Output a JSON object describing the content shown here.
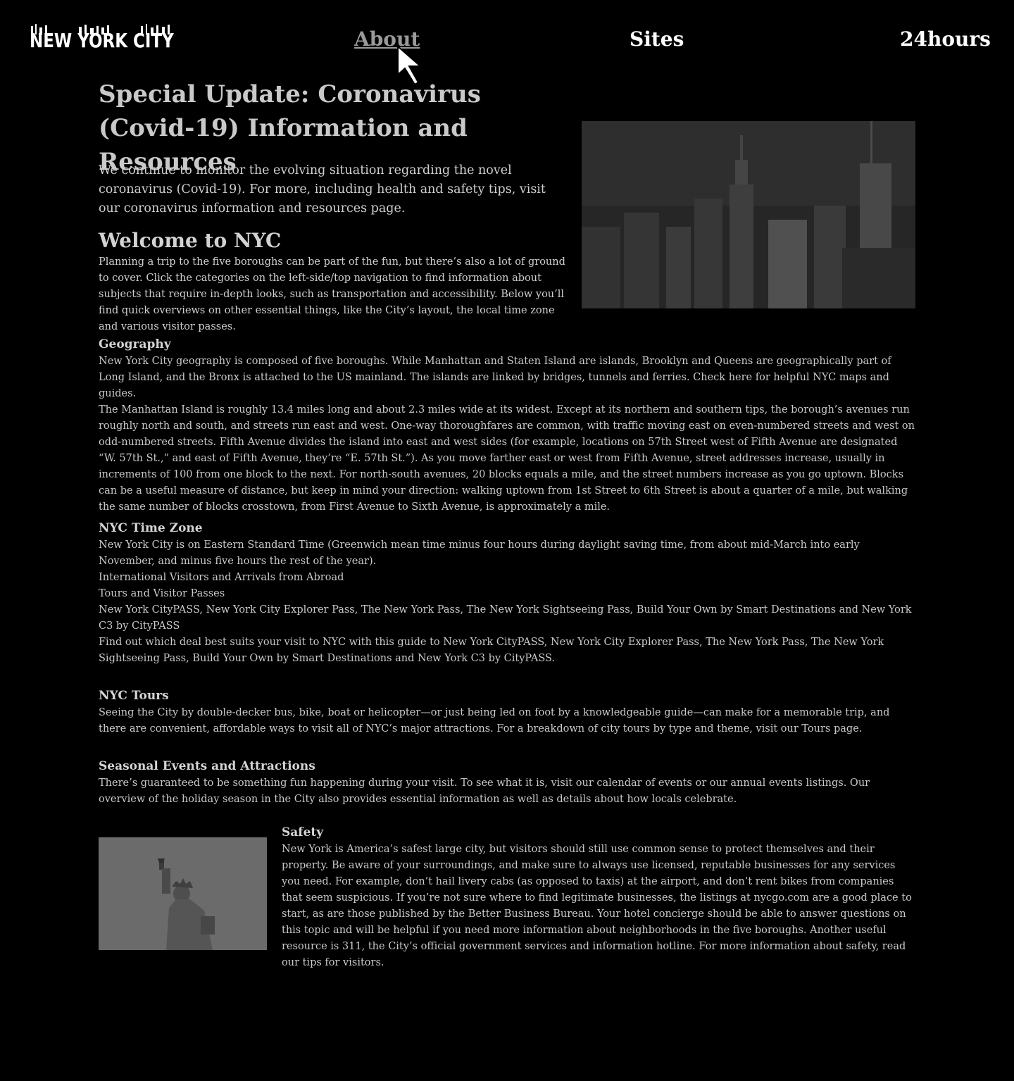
{
  "nav": {
    "logo_text": "NEW YORK CITY",
    "links": [
      "About",
      "Sites",
      "24hours"
    ]
  },
  "covid": {
    "title": "Special Update: Coronavirus (Covid-19) Information and Resources",
    "body": "We continue to monitor the evolving situation regarding the novel coronavirus (Covid-19). For more, including health and safety tips, visit our coronavirus information and resources page."
  },
  "welcome": {
    "title": "Welcome to NYC",
    "body": "Planning a trip to the five boroughs can be part of the fun, but there’s also a lot of ground to cover. Click the categories on the left-side/top navigation to find information about subjects that require in-depth looks, such as transportation and accessibility. Below you’ll find quick overviews on other essential things, like the City’s layout, the local time zone and various visitor passes."
  },
  "geography": {
    "title": "Geography",
    "p1": "New York City geography is composed of five boroughs.  While Manhattan and Staten Island are islands, Brooklyn and Queens are geographically part of Long Island, and the Bronx is attached to the US mainland. The islands are linked by bridges, tunnels and ferries. Check here for helpful NYC maps and guides.",
    "p2": "The Manhattan Island is roughly 13.4 miles long and about 2.3 miles wide at its widest. Except at its northern and southern tips, the borough’s avenues run roughly north and south, and streets run east and west. One-way thoroughfares are common, with traffic moving east on even-numbered streets and west on odd-numbered streets. Fifth Avenue divides the island into east and west sides (for example, locations on 57th Street west of Fifth Avenue are designated “W. 57th St.,” and east of Fifth Avenue, they’re “E. 57th St.”). As you move farther east or west from Fifth Avenue, street addresses increase, usually in increments of 100 from one block to the next. For north-south avenues, 20 blocks equals a mile, and the street numbers increase as you go uptown. Blocks can be a useful measure of distance, but keep in mind your direction: walking uptown from 1st Street to 6th Street is about a quarter of a mile, but walking the same number of blocks crosstown, from First Avenue to Sixth Avenue, is approximately a mile."
  },
  "timezone": {
    "title": "NYC Time Zone",
    "p1": "New York City is on Eastern Standard Time (Greenwich mean time minus four hours during daylight saving time, from about mid-March into early November, and minus five hours the rest of the year).",
    "p2": "International Visitors and Arrivals from Abroad",
    "p3": "Tours and Visitor Passes",
    "p4": "New York CityPASS, New York City Explorer Pass, The New York Pass, The New York Sightseeing Pass, Build Your Own by Smart Destinations and New York C3 by CityPASS",
    "p5": "Find out which deal best suits your visit to NYC with this guide to New York CityPASS, New York City Explorer Pass, The New York Pass, The New York Sightseeing Pass, Build Your Own by Smart Destinations and New York C3 by CityPASS."
  },
  "tours": {
    "title": "NYC Tours",
    "body": "Seeing the City by double-decker bus, bike, boat or helicopter—or just being led on foot by a knowledgeable guide—can make for a memorable trip, and there are convenient, affordable ways to visit all of NYC’s major attractions. For a breakdown of city tours by type and theme, visit our Tours page."
  },
  "seasonal": {
    "title": "Seasonal Events and Attractions",
    "body": "There’s guaranteed to be something fun happening during your visit. To see what it is, visit our calendar of events or our annual events listings. Our overview of the holiday season in the City also provides essential information as well as details about how locals celebrate."
  },
  "safety": {
    "title": "Safety",
    "body": "New York is America’s safest large city, but visitors should still use common sense to protect themselves and their property. Be aware of your surroundings, and make sure to always use licensed, reputable businesses for any services you need. For example, don’t hail livery cabs (as opposed to taxis) at the airport, and don’t rent bikes from companies that seem suspicious. If you’re not sure where to find legitimate businesses, the listings at nycgo.com are a good place to start, as are those published by the Better Business Bureau. Your hotel concierge should be able to answer questions on this topic and will be helpful if you need more information about neighborhoods in the five boroughs. Another useful resource is 311, the City’s official government services and information hotline. For more information about safety, read our tips for visitors."
  }
}
